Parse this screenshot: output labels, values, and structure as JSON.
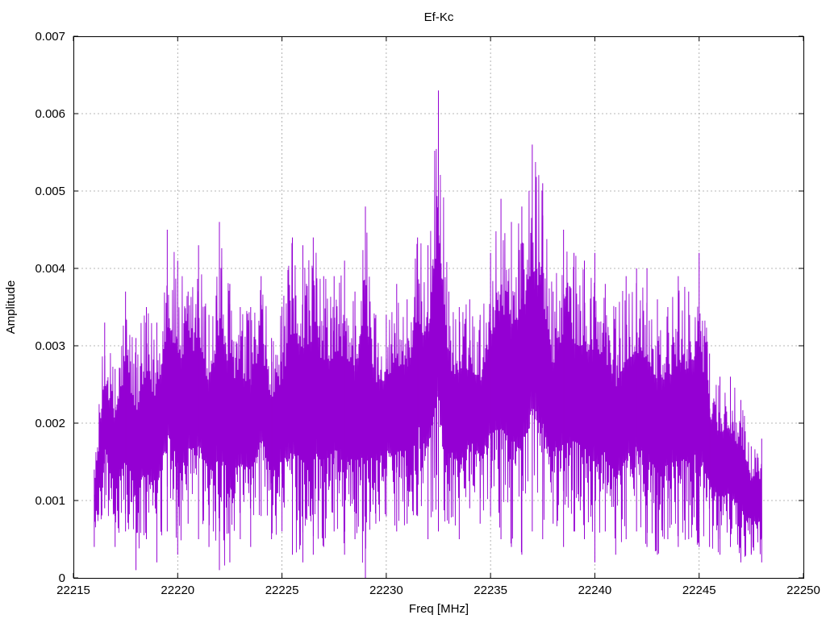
{
  "chart_data": {
    "type": "line",
    "title": "Ef-Kc",
    "xlabel": "Freq [MHz]",
    "ylabel": "Amplitude",
    "xlim": [
      22215,
      22250
    ],
    "ylim": [
      0,
      0.007
    ],
    "x_ticks": [
      "22215",
      "22220",
      "22225",
      "22230",
      "22235",
      "22240",
      "22245",
      "22250"
    ],
    "y_ticks": [
      "0",
      "0.001",
      "0.002",
      "0.003",
      "0.004",
      "0.005",
      "0.006",
      "0.007"
    ],
    "grid": true,
    "legend": "none",
    "series": [
      {
        "color": "#9400d3",
        "x": [
          22216.0,
          22216.5,
          22217.0,
          22217.5,
          22218.0,
          22218.5,
          22219.0,
          22219.5,
          22220.0,
          22220.5,
          22221.0,
          22221.5,
          22222.0,
          22222.5,
          22223.0,
          22223.5,
          22224.0,
          22224.5,
          22225.0,
          22225.5,
          22226.0,
          22226.5,
          22227.0,
          22227.5,
          22228.0,
          22228.5,
          22229.0,
          22229.5,
          22230.0,
          22230.5,
          22231.0,
          22231.5,
          22232.0,
          22232.5,
          22233.0,
          22233.5,
          22234.0,
          22234.5,
          22235.0,
          22235.5,
          22236.0,
          22236.5,
          22237.0,
          22237.5,
          22238.0,
          22238.5,
          22239.0,
          22239.5,
          22240.0,
          22240.5,
          22241.0,
          22241.5,
          22242.0,
          22242.5,
          22243.0,
          22243.5,
          22244.0,
          22244.5,
          22245.0,
          22245.5,
          22246.0,
          22246.5,
          22247.0,
          22247.5,
          22248.0
        ],
        "max": [
          0.0014,
          0.0033,
          0.0027,
          0.0037,
          0.0031,
          0.0035,
          0.0033,
          0.0045,
          0.0041,
          0.0037,
          0.0043,
          0.0034,
          0.0046,
          0.0038,
          0.0035,
          0.0035,
          0.0039,
          0.0031,
          0.0035,
          0.0044,
          0.0043,
          0.0044,
          0.0039,
          0.0039,
          0.0041,
          0.0037,
          0.0048,
          0.0034,
          0.0034,
          0.0038,
          0.0036,
          0.0044,
          0.0043,
          0.0063,
          0.0037,
          0.0035,
          0.0036,
          0.0034,
          0.0042,
          0.0049,
          0.0046,
          0.0048,
          0.0056,
          0.0051,
          0.0037,
          0.0045,
          0.0042,
          0.0041,
          0.0042,
          0.0038,
          0.0035,
          0.0039,
          0.004,
          0.004,
          0.0036,
          0.0035,
          0.0039,
          0.0037,
          0.0042,
          0.0029,
          0.0026,
          0.0026,
          0.0023,
          0.0017,
          0.0018
        ],
        "min": [
          0.0004,
          0.0009,
          0.0004,
          0.0006,
          0.0001,
          0.0005,
          0.0002,
          0.0006,
          0.0003,
          0.0007,
          0.0005,
          0.0004,
          0.0001,
          0.0002,
          0.0005,
          0.0004,
          0.0008,
          0.0005,
          0.0006,
          0.0003,
          0.0002,
          0.0003,
          0.0004,
          0.0006,
          0.0003,
          0.0005,
          0.0,
          0.0007,
          0.0008,
          0.0006,
          0.0007,
          0.0008,
          0.0005,
          0.0006,
          0.0007,
          0.0005,
          0.0009,
          0.0007,
          0.0008,
          0.0005,
          0.0004,
          0.0003,
          0.0006,
          0.0005,
          0.0007,
          0.0004,
          0.0006,
          0.0005,
          0.0002,
          0.0006,
          0.0003,
          0.0005,
          0.0006,
          0.0004,
          0.0003,
          0.0005,
          0.0004,
          0.0005,
          0.0004,
          0.0004,
          0.0003,
          0.0004,
          0.0002,
          0.0003,
          0.0002
        ]
      }
    ]
  }
}
